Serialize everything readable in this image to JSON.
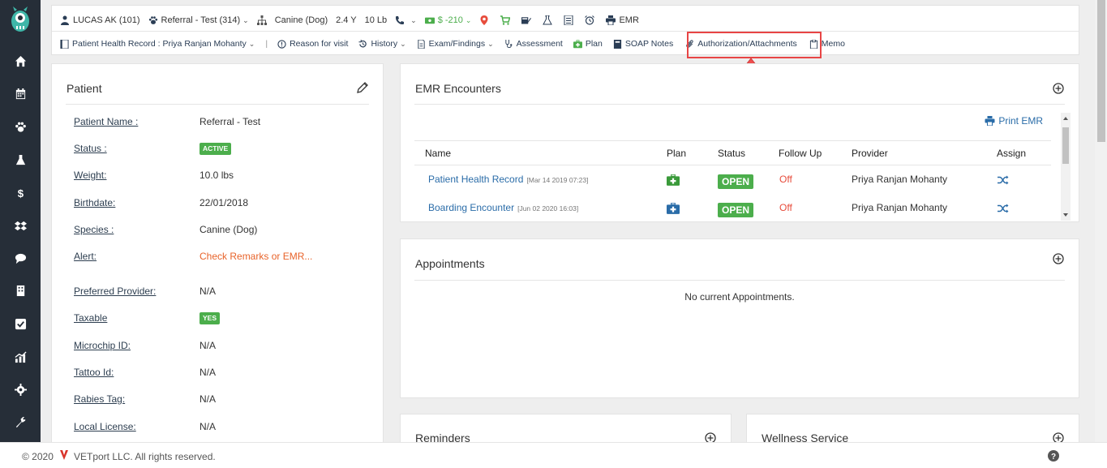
{
  "header": {
    "client": "LUCAS AK (101)",
    "patient": "Referral - Test (314)",
    "species": "Canine (Dog)",
    "age": "2.4 Y",
    "weight": "10 Lb",
    "balance": "$ -210",
    "emr_label": "EMR",
    "colors": {
      "balance": "#4cae4c",
      "location": "#e74c3c",
      "cart": "#4cae4c"
    }
  },
  "subnav": {
    "record": "Patient Health Record : Priya Ranjan Mohanty",
    "reason": "Reason for visit",
    "history": "History",
    "exam": "Exam/Findings",
    "assessment": "Assessment",
    "plan": "Plan",
    "soap": "SOAP Notes",
    "authorization": "Authorization/Attachments",
    "memo": "Memo"
  },
  "patient_panel": {
    "title": "Patient",
    "fields": [
      {
        "label": "Patient Name :",
        "value": "Referral - Test"
      },
      {
        "label": "Status :",
        "value": "ACTIVE"
      },
      {
        "label": "Weight:",
        "value": "10.0 lbs"
      },
      {
        "label": "Birthdate:",
        "value": "22/01/2018"
      },
      {
        "label": "Species :",
        "value": "Canine (Dog)"
      },
      {
        "label": "Alert:",
        "value": "Check Remarks or EMR..."
      },
      {
        "label": "Preferred Provider:",
        "value": "N/A"
      },
      {
        "label": "Taxable",
        "value": "YES"
      },
      {
        "label": "Microchip ID:",
        "value": "N/A"
      },
      {
        "label": "Tattoo Id:",
        "value": "N/A"
      },
      {
        "label": "Rabies Tag:",
        "value": "N/A"
      },
      {
        "label": "Local License:",
        "value": "N/A"
      }
    ]
  },
  "emr_panel": {
    "title": "EMR Encounters",
    "print_label": "Print EMR",
    "columns": [
      "Name",
      "Plan",
      "Status",
      "Follow Up",
      "Provider",
      "Assign"
    ],
    "rows": [
      {
        "name": "Patient Health Record",
        "date": "[Mar 14 2019 07:23]",
        "status": "OPEN",
        "follow_up": "Off",
        "provider": "Priya Ranjan Mohanty"
      },
      {
        "name": "Boarding Encounter",
        "date": "[Jun 02 2020 16:03]",
        "status": "OPEN",
        "follow_up": "Off",
        "provider": "Priya Ranjan Mohanty"
      }
    ]
  },
  "appointments_panel": {
    "title": "Appointments",
    "empty": "No current Appointments."
  },
  "reminders_panel": {
    "title": "Reminders"
  },
  "wellness_panel": {
    "title": "Wellness Service"
  },
  "footer": {
    "copyright": "© 2020",
    "company": "VETport LLC. All rights reserved."
  }
}
